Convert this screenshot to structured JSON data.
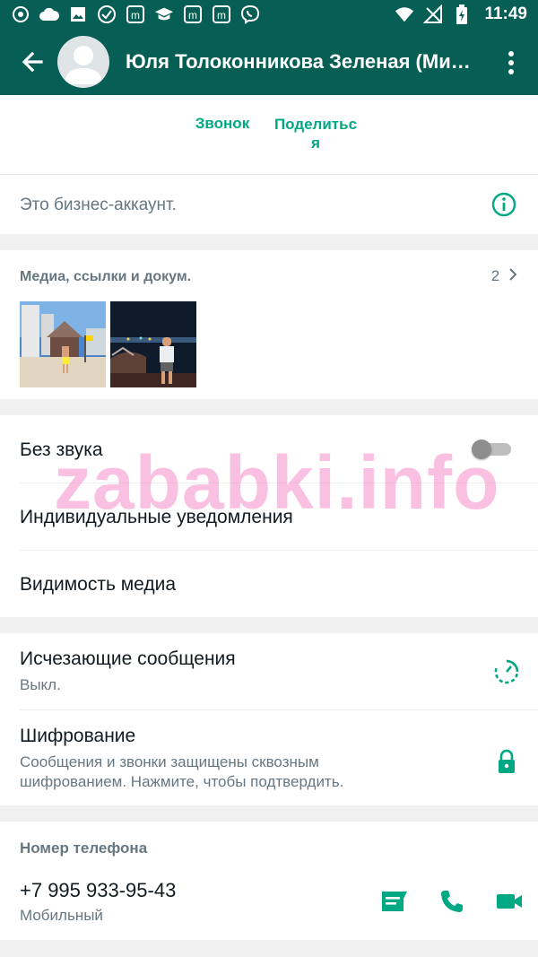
{
  "status_bar": {
    "time": "11:49",
    "left_icons": [
      "search-icon",
      "cloud-icon",
      "image-icon",
      "check-circle-icon",
      "m-app-icon",
      "graduation-cap-icon",
      "m-app-icon",
      "m-app-icon",
      "viber-icon"
    ],
    "right_icons": [
      "wifi-icon",
      "no-signal-icon",
      "battery-charging-icon"
    ]
  },
  "app_bar": {
    "title": "Юля Толоконникова Зеленая (Ми…"
  },
  "actions": {
    "call_label": "Звонок",
    "share_label": "Поделитьс я"
  },
  "business": {
    "text": "Это бизнес-аккаунт."
  },
  "media": {
    "header": "Медиа, ссылки и докум.",
    "count": "2"
  },
  "settings": {
    "mute_label": "Без звука",
    "mute_on": false,
    "custom_notifications_label": "Индивидуальные уведомления",
    "media_visibility_label": "Видимость медиа"
  },
  "privacy": {
    "disappearing_label": "Исчезающие сообщения",
    "disappearing_value": "Выкл.",
    "encryption_label": "Шифрование",
    "encryption_desc_line1": "Сообщения и звонки защищены сквозным",
    "encryption_desc_line2": "шифрованием. Нажмите, чтобы подтвердить."
  },
  "phone": {
    "header": "Номер телефона",
    "number": "+7 995 933-95-43",
    "type": "Мобильный"
  },
  "watermark": "zababki.info",
  "colors": {
    "header_bg": "#075e54",
    "accent": "#00a884",
    "secondary_text": "#667781",
    "watermark": "#f48cc8"
  }
}
